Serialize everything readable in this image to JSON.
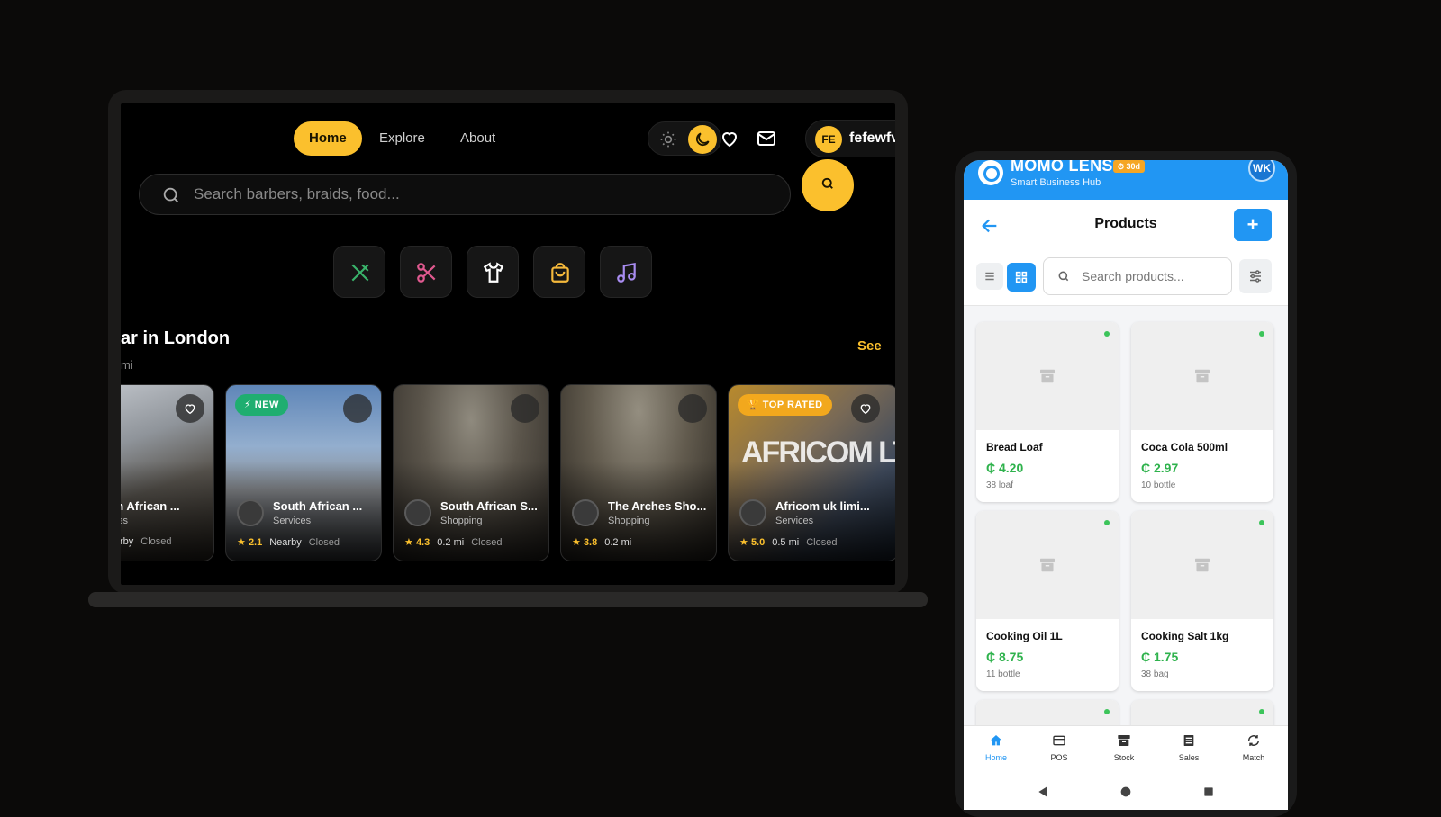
{
  "laptop": {
    "nav": {
      "home": "Home",
      "explore": "Explore",
      "about": "About"
    },
    "user": {
      "initials": "FE",
      "name": "fefewfv"
    },
    "search": {
      "placeholder": "Search barbers, braids, food..."
    },
    "categories": [
      {
        "icon": "utensils-icon",
        "color": "#39b36b"
      },
      {
        "icon": "scissors-icon",
        "color": "#e0598f"
      },
      {
        "icon": "tshirt-icon",
        "color": "#ffffff"
      },
      {
        "icon": "shopping-bag-icon",
        "color": "#f5b93b"
      },
      {
        "icon": "music-icon",
        "color": "#a88cf0"
      }
    ],
    "section": {
      "title": "ar in London",
      "subtitle": "mi",
      "see_all": "See"
    },
    "cards": [
      {
        "name": "uth African ...",
        "category": "vices",
        "rating": "",
        "distance": "rby",
        "status": "Closed",
        "badge": ""
      },
      {
        "name": "South African ...",
        "category": "Services",
        "rating": "2.1",
        "distance": "Nearby",
        "status": "Closed",
        "badge": "NEW"
      },
      {
        "name": "South African S...",
        "category": "Shopping",
        "rating": "4.3",
        "distance": "0.2 mi",
        "status": "Closed",
        "badge": ""
      },
      {
        "name": "The Arches Sho...",
        "category": "Shopping",
        "rating": "3.8",
        "distance": "0.2 mi",
        "status": "",
        "badge": ""
      },
      {
        "name": "Africom uk limi...",
        "category": "Services",
        "rating": "5.0",
        "distance": "0.5 mi",
        "status": "Closed",
        "badge": "TOP RATED",
        "image_text": "AFRICOM LTD"
      }
    ],
    "colors": {
      "accent": "#fbc02d",
      "background": "#000000"
    }
  },
  "phone": {
    "app": {
      "title": "MOMO LENS",
      "trial": "30d",
      "subtitle": "Smart Business Hub",
      "avatar": "WK"
    },
    "page_title": "Products",
    "add_label": "+",
    "search": {
      "placeholder": "Search products..."
    },
    "products": [
      {
        "name": "Bread Loaf",
        "price": "₵ 4.20",
        "stock": "38 loaf"
      },
      {
        "name": "Coca Cola 500ml",
        "price": "₵ 2.97",
        "stock": "10 bottle"
      },
      {
        "name": "Cooking Oil 1L",
        "price": "₵ 8.75",
        "stock": "11 bottle"
      },
      {
        "name": "Cooking Salt 1kg",
        "price": "₵ 1.75",
        "stock": "38 bag"
      }
    ],
    "tabs": [
      {
        "label": "Home",
        "icon": "home-icon",
        "active": true
      },
      {
        "label": "POS",
        "icon": "card-icon"
      },
      {
        "label": "Stock",
        "icon": "archive-icon"
      },
      {
        "label": "Sales",
        "icon": "receipt-icon"
      },
      {
        "label": "Match",
        "icon": "sync-icon"
      }
    ],
    "colors": {
      "primary": "#2196f3",
      "price": "#2eb24c",
      "stock_dot": "#3cc45a"
    }
  }
}
